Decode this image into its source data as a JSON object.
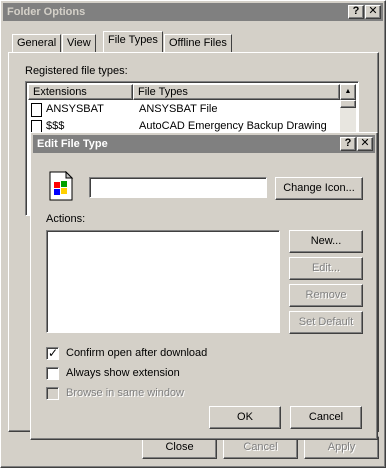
{
  "folder_options": {
    "title": "Folder Options",
    "tabs": [
      "General",
      "View",
      "File Types",
      "Offline Files"
    ],
    "registered_label": "Registered file types:",
    "columns": [
      "Extensions",
      "File Types"
    ],
    "rows": [
      {
        "ext": "ANSYSBAT",
        "type": "ANSYSBAT File"
      },
      {
        "ext": "$$$",
        "type": "AutoCAD Emergency Backup Drawing"
      }
    ],
    "buttons": {
      "close": "Close",
      "cancel": "Cancel",
      "apply": "Apply"
    }
  },
  "edit_file_type": {
    "title": "Edit File Type",
    "description_value": "",
    "change_icon_label": "Change Icon...",
    "actions_label": "Actions:",
    "buttons": {
      "new": "New...",
      "edit": "Edit...",
      "remove": "Remove",
      "set_default": "Set Default",
      "ok": "OK",
      "cancel": "Cancel"
    },
    "checkboxes": [
      {
        "label": "Confirm open after download",
        "checked": true,
        "enabled": true
      },
      {
        "label": "Always show extension",
        "checked": false,
        "enabled": true
      },
      {
        "label": "Browse in same window",
        "checked": false,
        "enabled": false
      }
    ]
  },
  "icons": {
    "help": "?",
    "close": "✕",
    "scroll_up": "▲"
  }
}
